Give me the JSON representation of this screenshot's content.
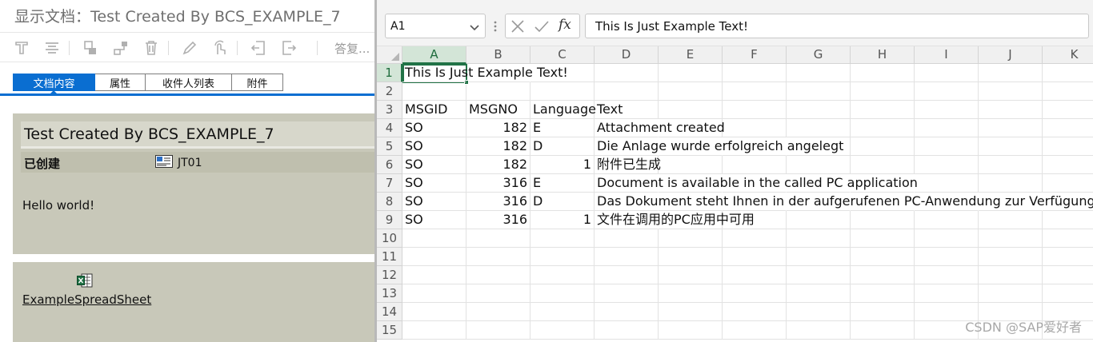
{
  "sap": {
    "title": "显示文档：Test Created By BCS_EXAMPLE_7",
    "toolbar": {
      "more_label": "答复..."
    },
    "tabs": [
      {
        "label": "文档内容",
        "active": true
      },
      {
        "label": "属性",
        "active": false
      },
      {
        "label": "收件人列表",
        "active": false
      },
      {
        "label": "附件",
        "active": false
      }
    ],
    "document": {
      "title": "Test Created By BCS_EXAMPLE_7",
      "status_label": "已创建",
      "user": "JT01",
      "body": "Hello world!"
    },
    "attachment": {
      "name": "ExampleSpreadSheet",
      "icon": "excel-file-icon"
    }
  },
  "excel": {
    "namebox": "A1",
    "formula": "This Is Just Example Text!",
    "formula_icons": [
      "cancel-icon",
      "enter-icon",
      "fx-icon"
    ],
    "selected_cell": "A1",
    "columns": [
      "A",
      "B",
      "C",
      "D",
      "E",
      "F",
      "G",
      "H",
      "I",
      "J",
      "K"
    ],
    "rows": [
      "1",
      "2",
      "3",
      "4",
      "5",
      "6",
      "7",
      "8",
      "9",
      "10",
      "11",
      "12",
      "13",
      "14",
      "15"
    ],
    "cells": {
      "A1": "This Is Just Example Text!",
      "A3": "MSGID",
      "B3": "MSGNO",
      "C3": "Language",
      "D3": "Text",
      "A4": "SO",
      "B4": "182",
      "C4": "E",
      "D4": "Attachment created",
      "A5": "SO",
      "B5": "182",
      "C5": "D",
      "D5": "Die Anlage wurde erfolgreich angelegt",
      "A6": "SO",
      "B6": "182",
      "C6": "1",
      "D6": "附件已生成",
      "A7": "SO",
      "B7": "316",
      "C7": "E",
      "D7": "Document is available in the called PC application",
      "A8": "SO",
      "B8": "316",
      "C8": "D",
      "D8": "Das Dokument steht Ihnen in der aufgerufenen PC-Anwendung zur Verfügung",
      "A9": "SO",
      "B9": "316",
      "C9": "1",
      "D9": "文件在调用的PC应用中可用"
    },
    "numeric_cells": [
      "B4",
      "B5",
      "B6",
      "B7",
      "B8",
      "B9",
      "C6",
      "C9"
    ],
    "accent_color": "#217346"
  },
  "watermark": "CSDN @SAP爱好者"
}
